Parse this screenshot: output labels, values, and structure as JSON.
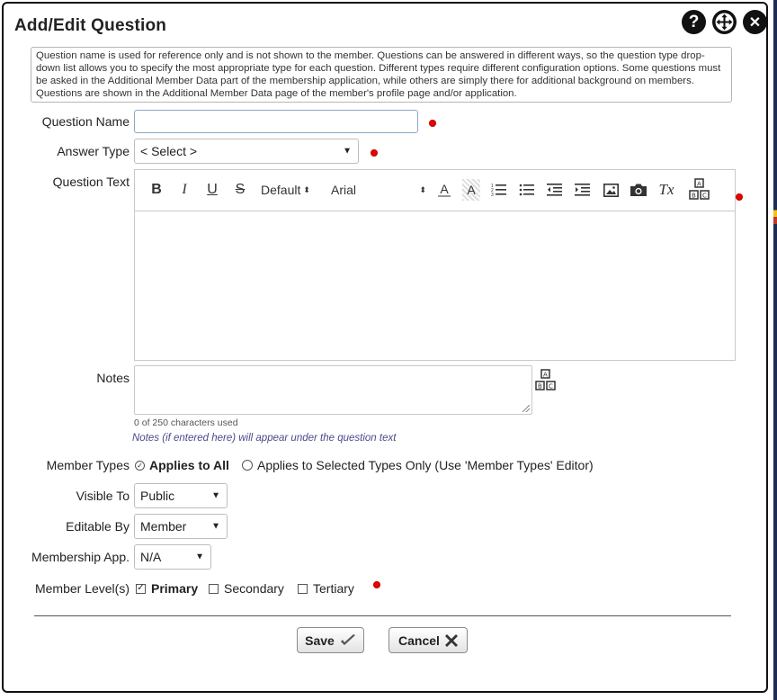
{
  "dialog": {
    "title": "Add/Edit Question",
    "help_glyph": "?",
    "close_glyph": "✕",
    "info": "Question name is used for reference only and is not shown to the member. Questions can be answered in different ways, so the question type drop-down list allows you to specify the most appropriate type for each question. Different types require different configuration options. Some questions must be asked in the Additional Member Data part of the membership application, while others are simply there for additional background on members. Questions are shown in the Additional Member Data page of the member's profile page and/or application."
  },
  "form": {
    "question_name": {
      "label": "Question Name",
      "value": ""
    },
    "answer_type": {
      "label": "Answer Type",
      "value": "< Select >"
    },
    "question_text": {
      "label": "Question Text",
      "toolbar": {
        "bold": "B",
        "italic": "I",
        "underline": "U",
        "strike": "S",
        "size": "Default",
        "font": "Arial",
        "font_color_glyph": "A",
        "bg_color_glyph": "A",
        "clear_glyph": "Tx"
      }
    },
    "notes": {
      "label": "Notes",
      "counter": "0 of 250 characters used",
      "hint": "Notes (if entered here) will appear under the question text"
    },
    "member_types": {
      "label": "Member Types",
      "option_all": "Applies to All",
      "option_selected": "Applies to Selected Types Only (Use 'Member Types' Editor)",
      "selected": "all"
    },
    "visible_to": {
      "label": "Visible To",
      "value": "Public"
    },
    "editable_by": {
      "label": "Editable By",
      "value": "Member"
    },
    "membership_app": {
      "label": "Membership App.",
      "value": "N/A"
    },
    "member_levels": {
      "label": "Member Level(s)",
      "options": [
        {
          "label": "Primary",
          "checked": true
        },
        {
          "label": "Secondary",
          "checked": false
        },
        {
          "label": "Tertiary",
          "checked": false
        }
      ]
    }
  },
  "buttons": {
    "save": "Save",
    "cancel": "Cancel"
  },
  "colors": {
    "required_dot": "#e00000",
    "input_border_focus": "#8aa8c9",
    "hint_text": "#4a4a8a"
  }
}
